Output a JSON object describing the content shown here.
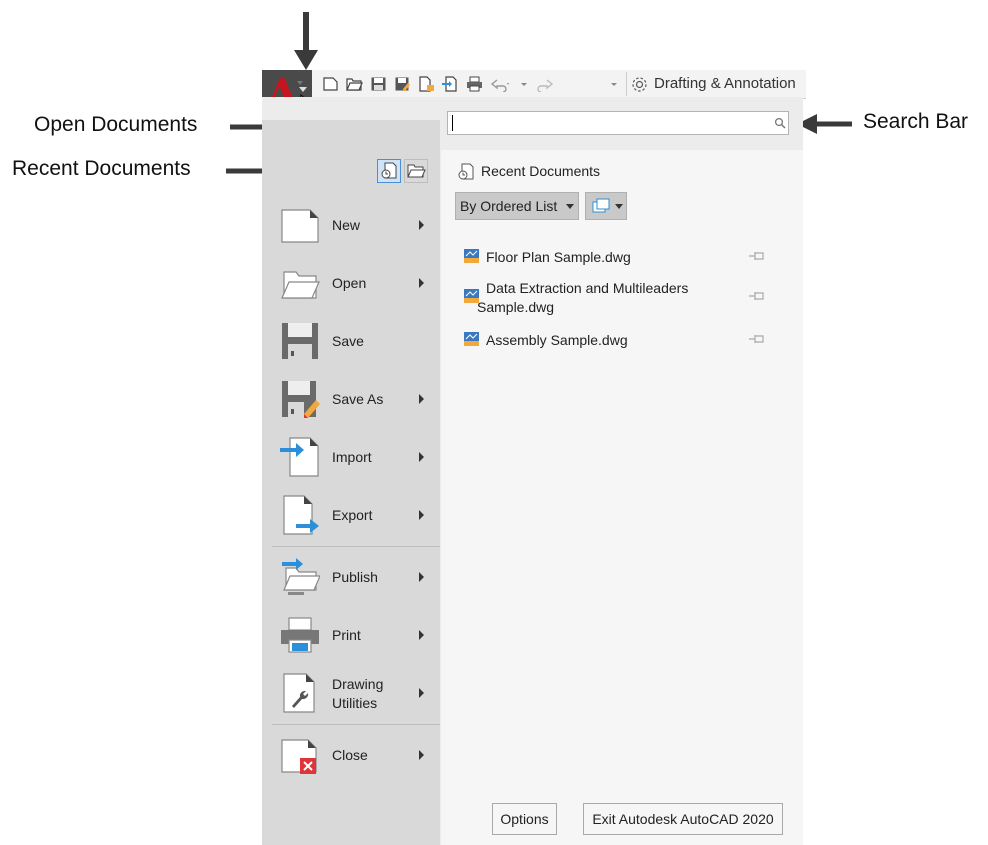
{
  "callouts": {
    "open_documents": "Open Documents",
    "recent_documents": "Recent Documents",
    "search_bar": "Search Bar"
  },
  "toolbar": {
    "workspace_label": "Drafting & Annotation"
  },
  "panel": {
    "recent_title": "Recent Documents",
    "order_dropdown": "By Ordered List"
  },
  "menu": {
    "new": "New",
    "open": "Open",
    "save": "Save",
    "save_as": "Save As",
    "import": "Import",
    "export": "Export",
    "publish": "Publish",
    "print": "Print",
    "drawing_utilities_1": "Drawing",
    "drawing_utilities_2": "Utilities",
    "close": "Close"
  },
  "documents": [
    {
      "name_line1": "Floor Plan Sample.dwg",
      "name_line2": ""
    },
    {
      "name_line1": "Data Extraction and Multileaders",
      "name_line2": "Sample.dwg"
    },
    {
      "name_line1": "Assembly Sample.dwg",
      "name_line2": ""
    }
  ],
  "buttons": {
    "options": "Options",
    "exit": "Exit Autodesk AutoCAD 2020"
  },
  "colors": {
    "app_red": "#c8141e",
    "accent_blue": "#2b8fd9",
    "close_red": "#e0343b"
  }
}
